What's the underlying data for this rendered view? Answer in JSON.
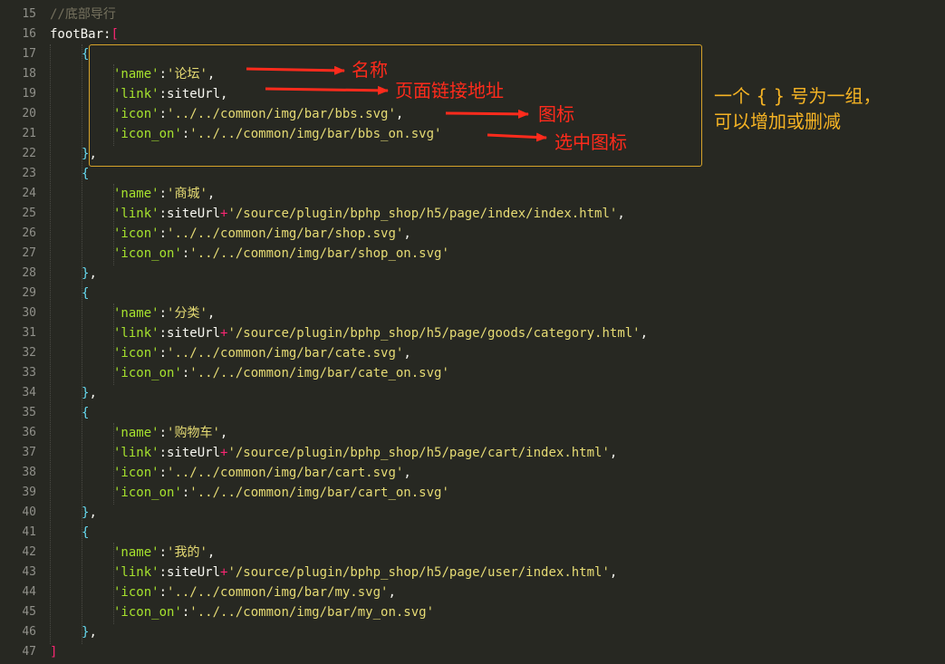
{
  "editor": {
    "lines": [
      {
        "num": "15",
        "indent": 1,
        "tokens": [
          {
            "t": "//底部导行",
            "c": "comment"
          }
        ]
      },
      {
        "num": "16",
        "indent": 1,
        "tokens": [
          {
            "t": "footBar:",
            "c": "default"
          },
          {
            "t": "[",
            "c": "bracket"
          }
        ]
      },
      {
        "num": "17",
        "indent": 2,
        "tokens": [
          {
            "t": "{",
            "c": "brace"
          }
        ]
      },
      {
        "num": "18",
        "indent": 3,
        "tokens": [
          {
            "t": "'name'",
            "c": "key"
          },
          {
            "t": ":",
            "c": "default"
          },
          {
            "t": "'论坛'",
            "c": "string"
          },
          {
            "t": ",",
            "c": "default"
          }
        ]
      },
      {
        "num": "19",
        "indent": 3,
        "tokens": [
          {
            "t": "'link'",
            "c": "key"
          },
          {
            "t": ":siteUrl,",
            "c": "default"
          }
        ]
      },
      {
        "num": "20",
        "indent": 3,
        "tokens": [
          {
            "t": "'icon'",
            "c": "key"
          },
          {
            "t": ":",
            "c": "default"
          },
          {
            "t": "'../../common/img/bar/bbs.svg'",
            "c": "string"
          },
          {
            "t": ",",
            "c": "default"
          }
        ]
      },
      {
        "num": "21",
        "indent": 3,
        "tokens": [
          {
            "t": "'icon_on'",
            "c": "key"
          },
          {
            "t": ":",
            "c": "default"
          },
          {
            "t": "'../../common/img/bar/bbs_on.svg'",
            "c": "string"
          }
        ]
      },
      {
        "num": "22",
        "indent": 2,
        "tokens": [
          {
            "t": "}",
            "c": "brace"
          },
          {
            "t": ",",
            "c": "default"
          }
        ]
      },
      {
        "num": "23",
        "indent": 2,
        "tokens": [
          {
            "t": "{",
            "c": "brace"
          }
        ]
      },
      {
        "num": "24",
        "indent": 3,
        "tokens": [
          {
            "t": "'name'",
            "c": "key"
          },
          {
            "t": ":",
            "c": "default"
          },
          {
            "t": "'商城'",
            "c": "string"
          },
          {
            "t": ",",
            "c": "default"
          }
        ]
      },
      {
        "num": "25",
        "indent": 3,
        "tokens": [
          {
            "t": "'link'",
            "c": "key"
          },
          {
            "t": ":siteUrl",
            "c": "default"
          },
          {
            "t": "+",
            "c": "op"
          },
          {
            "t": "'/source/plugin/bphp_shop/h5/page/index/index.html'",
            "c": "string"
          },
          {
            "t": ",",
            "c": "default"
          }
        ]
      },
      {
        "num": "26",
        "indent": 3,
        "tokens": [
          {
            "t": "'icon'",
            "c": "key"
          },
          {
            "t": ":",
            "c": "default"
          },
          {
            "t": "'../../common/img/bar/shop.svg'",
            "c": "string"
          },
          {
            "t": ",",
            "c": "default"
          }
        ]
      },
      {
        "num": "27",
        "indent": 3,
        "tokens": [
          {
            "t": "'icon_on'",
            "c": "key"
          },
          {
            "t": ":",
            "c": "default"
          },
          {
            "t": "'../../common/img/bar/shop_on.svg'",
            "c": "string"
          }
        ]
      },
      {
        "num": "28",
        "indent": 2,
        "tokens": [
          {
            "t": "}",
            "c": "brace"
          },
          {
            "t": ",",
            "c": "default"
          }
        ]
      },
      {
        "num": "29",
        "indent": 2,
        "tokens": [
          {
            "t": "{",
            "c": "brace"
          }
        ]
      },
      {
        "num": "30",
        "indent": 3,
        "tokens": [
          {
            "t": "'name'",
            "c": "key"
          },
          {
            "t": ":",
            "c": "default"
          },
          {
            "t": "'分类'",
            "c": "string"
          },
          {
            "t": ",",
            "c": "default"
          }
        ]
      },
      {
        "num": "31",
        "indent": 3,
        "tokens": [
          {
            "t": "'link'",
            "c": "key"
          },
          {
            "t": ":siteUrl",
            "c": "default"
          },
          {
            "t": "+",
            "c": "op"
          },
          {
            "t": "'/source/plugin/bphp_shop/h5/page/goods/category.html'",
            "c": "string"
          },
          {
            "t": ",",
            "c": "default"
          }
        ]
      },
      {
        "num": "32",
        "indent": 3,
        "tokens": [
          {
            "t": "'icon'",
            "c": "key"
          },
          {
            "t": ":",
            "c": "default"
          },
          {
            "t": "'../../common/img/bar/cate.svg'",
            "c": "string"
          },
          {
            "t": ",",
            "c": "default"
          }
        ]
      },
      {
        "num": "33",
        "indent": 3,
        "tokens": [
          {
            "t": "'icon_on'",
            "c": "key"
          },
          {
            "t": ":",
            "c": "default"
          },
          {
            "t": "'../../common/img/bar/cate_on.svg'",
            "c": "string"
          }
        ]
      },
      {
        "num": "34",
        "indent": 2,
        "tokens": [
          {
            "t": "}",
            "c": "brace"
          },
          {
            "t": ",",
            "c": "default"
          }
        ]
      },
      {
        "num": "35",
        "indent": 2,
        "tokens": [
          {
            "t": "{",
            "c": "brace"
          }
        ]
      },
      {
        "num": "36",
        "indent": 3,
        "tokens": [
          {
            "t": "'name'",
            "c": "key"
          },
          {
            "t": ":",
            "c": "default"
          },
          {
            "t": "'购物车'",
            "c": "string"
          },
          {
            "t": ",",
            "c": "default"
          }
        ]
      },
      {
        "num": "37",
        "indent": 3,
        "tokens": [
          {
            "t": "'link'",
            "c": "key"
          },
          {
            "t": ":siteUrl",
            "c": "default"
          },
          {
            "t": "+",
            "c": "op"
          },
          {
            "t": "'/source/plugin/bphp_shop/h5/page/cart/index.html'",
            "c": "string"
          },
          {
            "t": ",",
            "c": "default"
          }
        ]
      },
      {
        "num": "38",
        "indent": 3,
        "tokens": [
          {
            "t": "'icon'",
            "c": "key"
          },
          {
            "t": ":",
            "c": "default"
          },
          {
            "t": "'../../common/img/bar/cart.svg'",
            "c": "string"
          },
          {
            "t": ",",
            "c": "default"
          }
        ]
      },
      {
        "num": "39",
        "indent": 3,
        "tokens": [
          {
            "t": "'icon_on'",
            "c": "key"
          },
          {
            "t": ":",
            "c": "default"
          },
          {
            "t": "'../../common/img/bar/cart_on.svg'",
            "c": "string"
          }
        ]
      },
      {
        "num": "40",
        "indent": 2,
        "tokens": [
          {
            "t": "}",
            "c": "brace"
          },
          {
            "t": ",",
            "c": "default"
          }
        ]
      },
      {
        "num": "41",
        "indent": 2,
        "tokens": [
          {
            "t": "{",
            "c": "brace"
          }
        ]
      },
      {
        "num": "42",
        "indent": 3,
        "tokens": [
          {
            "t": "'name'",
            "c": "key"
          },
          {
            "t": ":",
            "c": "default"
          },
          {
            "t": "'我的'",
            "c": "string"
          },
          {
            "t": ",",
            "c": "default"
          }
        ]
      },
      {
        "num": "43",
        "indent": 3,
        "tokens": [
          {
            "t": "'link'",
            "c": "key"
          },
          {
            "t": ":siteUrl",
            "c": "default"
          },
          {
            "t": "+",
            "c": "op"
          },
          {
            "t": "'/source/plugin/bphp_shop/h5/page/user/index.html'",
            "c": "string"
          },
          {
            "t": ",",
            "c": "default"
          }
        ]
      },
      {
        "num": "44",
        "indent": 3,
        "tokens": [
          {
            "t": "'icon'",
            "c": "key"
          },
          {
            "t": ":",
            "c": "default"
          },
          {
            "t": "'../../common/img/bar/my.svg'",
            "c": "string"
          },
          {
            "t": ",",
            "c": "default"
          }
        ]
      },
      {
        "num": "45",
        "indent": 3,
        "tokens": [
          {
            "t": "'icon_on'",
            "c": "key"
          },
          {
            "t": ":",
            "c": "default"
          },
          {
            "t": "'../../common/img/bar/my_on.svg'",
            "c": "string"
          }
        ]
      },
      {
        "num": "46",
        "indent": 2,
        "tokens": [
          {
            "t": "}",
            "c": "brace"
          },
          {
            "t": ",",
            "c": "default"
          }
        ]
      },
      {
        "num": "47",
        "indent": 1,
        "tokens": [
          {
            "t": "]",
            "c": "bracket"
          }
        ]
      }
    ]
  },
  "annotations": {
    "name_label": "名称",
    "link_label": "页面链接地址",
    "icon_label": "图标",
    "icon_on_label": "选中图标",
    "side_note_line1": "一个 { } 号为一组，",
    "side_note_line2": "可以增加或删减"
  },
  "colors": {
    "background": "#272822",
    "annotation_red": "#ff2b1c",
    "annotation_orange": "#f5b324",
    "highlight_border": "#d6a32a"
  }
}
